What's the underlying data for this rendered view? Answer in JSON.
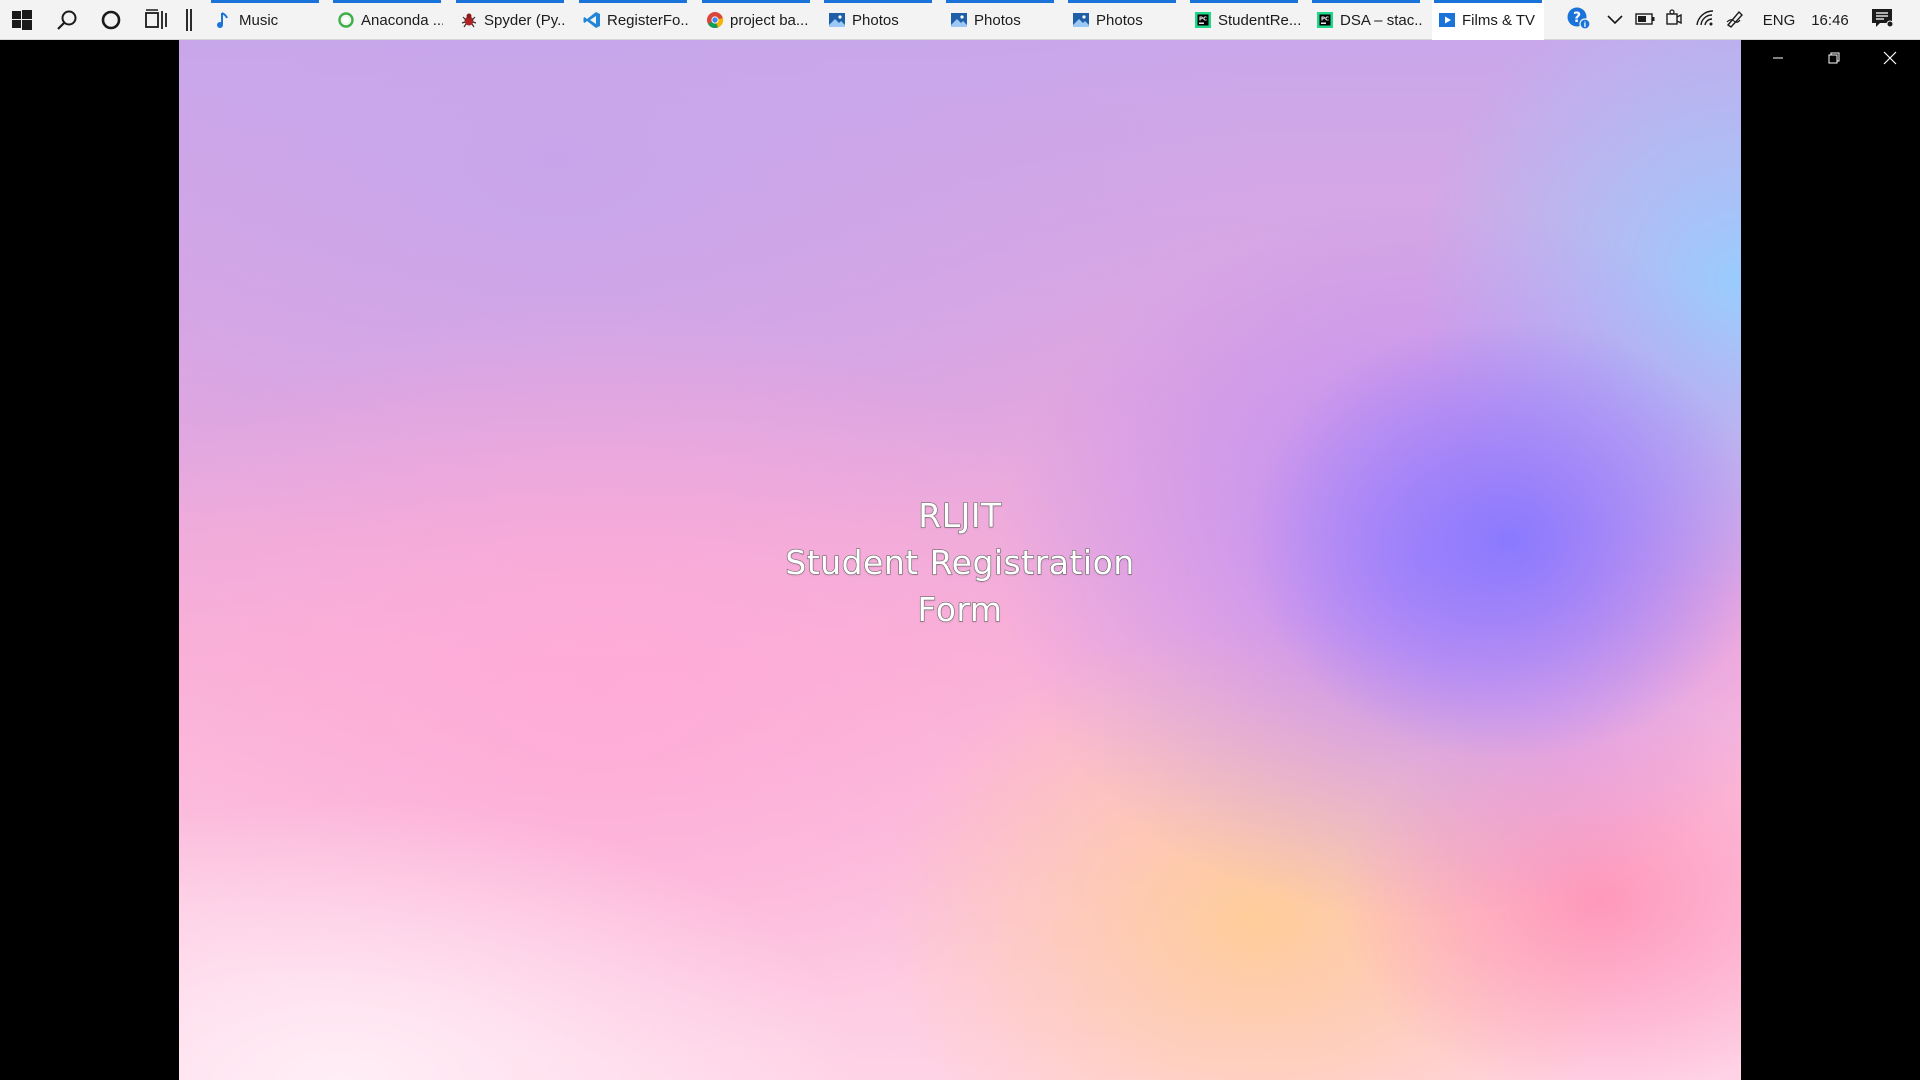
{
  "taskbar": {
    "system_buttons": [
      {
        "icon": "windows-start-icon"
      },
      {
        "icon": "search-icon"
      },
      {
        "icon": "cortana-icon"
      },
      {
        "icon": "task-view-icon"
      }
    ],
    "apps": [
      {
        "label": "Music",
        "icon": "music-note-icon",
        "active": false
      },
      {
        "label": "Anaconda ...",
        "icon": "anaconda-icon",
        "active": false
      },
      {
        "label": "Spyder (Py...",
        "icon": "spyder-icon",
        "active": false
      },
      {
        "label": "RegisterFo...",
        "icon": "vscode-icon",
        "active": false
      },
      {
        "label": "project ba...",
        "icon": "chrome-icon",
        "active": false
      },
      {
        "label": "Photos",
        "icon": "photos-icon",
        "active": false
      },
      {
        "label": "Photos",
        "icon": "photos-icon",
        "active": false
      },
      {
        "label": "Photos",
        "icon": "photos-icon",
        "active": false
      },
      {
        "label": "StudentRe...",
        "icon": "pycharm-icon",
        "active": false
      },
      {
        "label": "DSA – stac...",
        "icon": "pycharm-icon",
        "active": false
      },
      {
        "label": "Films & TV",
        "icon": "films-tv-icon",
        "active": true
      }
    ],
    "tray": {
      "help_icon": "help-icon",
      "overflow_icon": "chevron-up-icon",
      "battery_icon": "battery-icon",
      "meet_icon": "meet-now-icon",
      "wifi_icon": "wifi-icon",
      "pen_icon": "pen-icon",
      "language": "ENG",
      "time": "16:46",
      "notification_icon": "notification-icon"
    }
  },
  "player": {
    "app": "Films & TV",
    "title_lines": [
      "RLJIT",
      "Student Registration",
      "Form"
    ],
    "window_controls": [
      "minimize-icon",
      "restore-icon",
      "close-icon"
    ]
  },
  "colors": {
    "taskbar_bg": "#f3f3f3",
    "accent": "#1a73d9",
    "letterbox": "#000000"
  }
}
